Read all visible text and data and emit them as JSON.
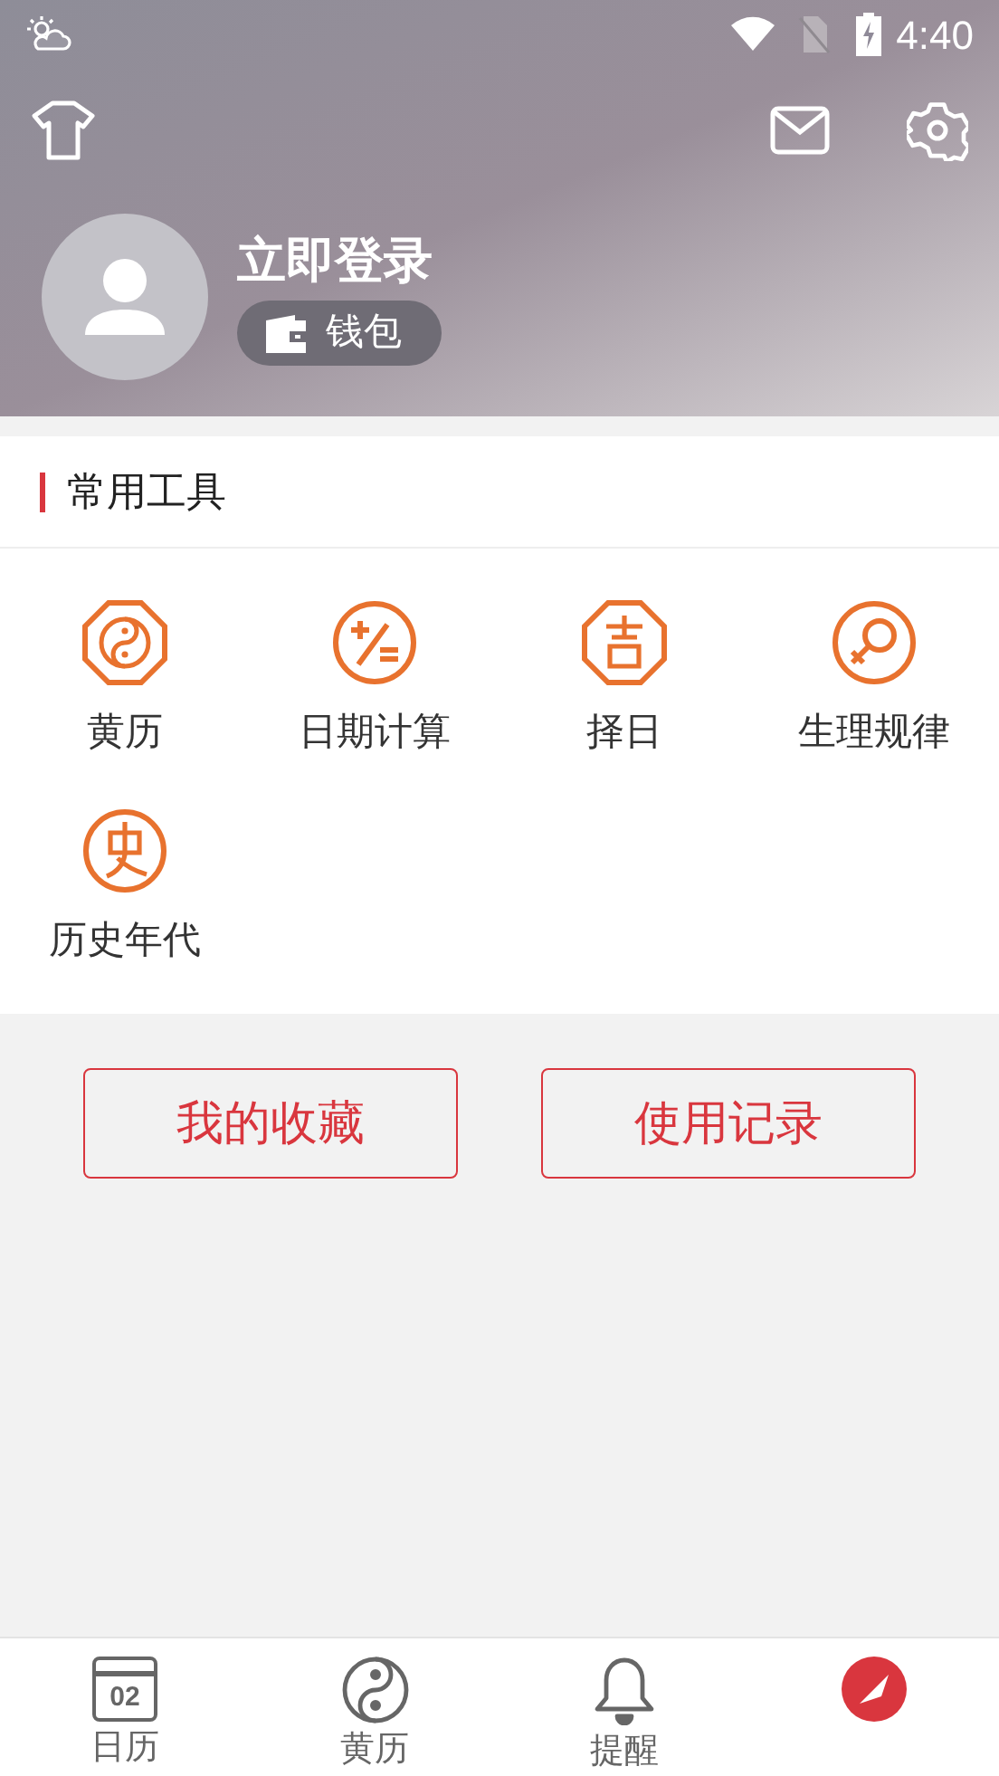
{
  "status_bar": {
    "time": "4:40"
  },
  "profile": {
    "login": "立即登录",
    "wallet": "钱包"
  },
  "tools_section": {
    "title": "常用工具",
    "tools": [
      {
        "label": "黄历",
        "kind": "yinyang"
      },
      {
        "label": "日期计算",
        "kind": "calc"
      },
      {
        "label": "择日",
        "kind": "ji"
      },
      {
        "label": "生理规律",
        "kind": "female"
      },
      {
        "label": "历史年代",
        "kind": "history"
      }
    ]
  },
  "buttons": [
    "我的收藏",
    "使用记录"
  ],
  "tabs": [
    {
      "label": "日历",
      "kind": "calendar",
      "icon_text": "02",
      "selected": false
    },
    {
      "label": "黄历",
      "kind": "yinyang",
      "selected": false
    },
    {
      "label": "提醒",
      "kind": "bell",
      "selected": false
    },
    {
      "kind": "me",
      "selected": true
    }
  ]
}
